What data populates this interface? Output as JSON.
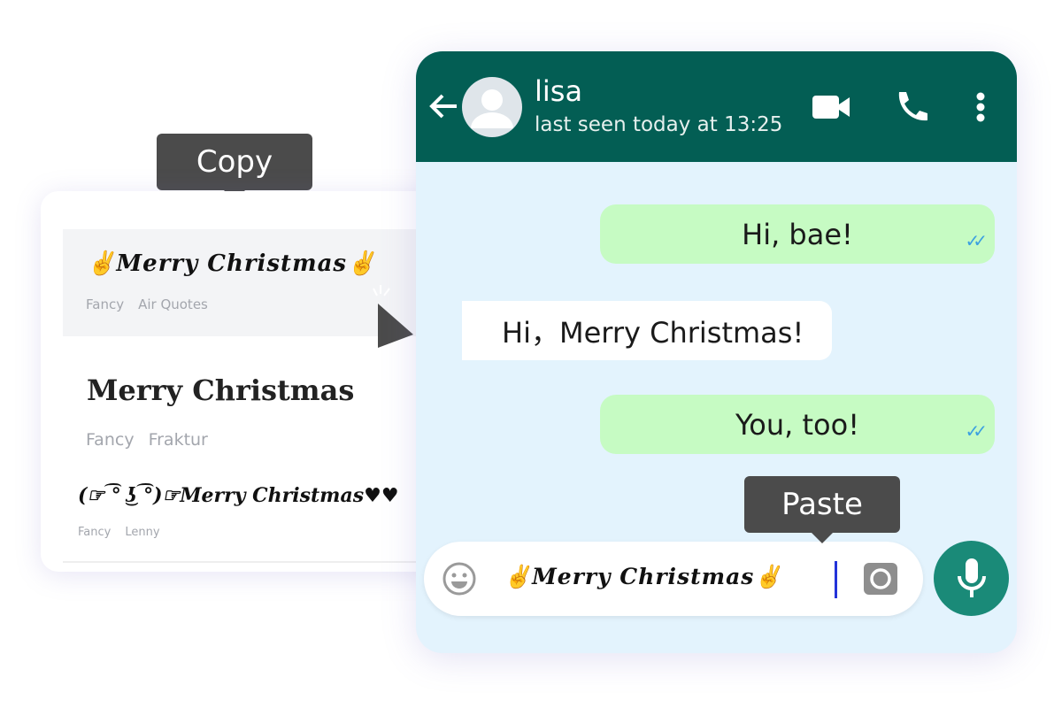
{
  "copy_tooltip": "Copy",
  "paste_tooltip": "Paste",
  "font_list": [
    {
      "text": "✌Merry Christmas✌",
      "tags": [
        "Fancy",
        "Air Quotes"
      ],
      "selected": true
    },
    {
      "text": "Merry Christmas",
      "tags": [
        "Fancy",
        "Fraktur"
      ],
      "selected": false
    },
    {
      "text": "(☞ ͡° ͜ʖ ͡°)☞Merry Christmas♥♥",
      "tags": [
        "Fancy",
        "Lenny"
      ],
      "selected": false
    }
  ],
  "chat": {
    "contact_name": "lisa",
    "status": "last seen today at 13:25",
    "messages": [
      {
        "text": "Hi, bae!",
        "direction": "outgoing",
        "read": true
      },
      {
        "text": "Hi，Merry Christmas!",
        "direction": "incoming"
      },
      {
        "text": "You, too!",
        "direction": "outgoing",
        "read": true
      }
    ],
    "input_value": "✌Merry Christmas✌",
    "read_check": "✓✓"
  },
  "colors": {
    "header": "#035e54",
    "chat_bg": "#e3f3fd",
    "outgoing": "#c6fbc3",
    "mic": "#1a8a78",
    "tooltip": "#4b4b4b"
  }
}
